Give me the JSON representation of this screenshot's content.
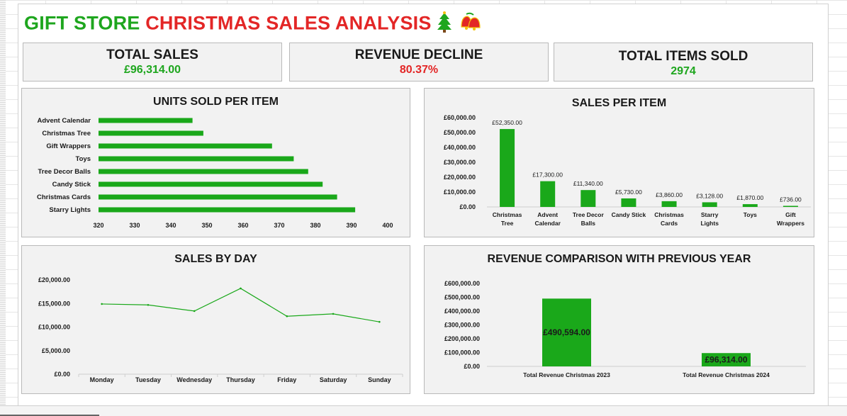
{
  "title": {
    "part1": "GIFT STORE",
    "part2": "CHRISTMAS SALES ANALYSIS",
    "icons": [
      "christmas-tree-icon",
      "bells-icon"
    ]
  },
  "kpis": [
    {
      "label": "TOTAL SALES",
      "value": "£96,314.00",
      "color": "#1ea61e"
    },
    {
      "label": "REVENUE DECLINE",
      "value": "80.37%",
      "color": "#e32626"
    },
    {
      "label": "TOTAL ITEMS SOLD",
      "value": "2974",
      "color": "#1ea61e"
    }
  ],
  "colors": {
    "bar": "#1aa81a",
    "line": "#1aa81a",
    "green_text": "#1ea61e",
    "red_text": "#e32626"
  },
  "chart_data": [
    {
      "type": "bar",
      "orientation": "horizontal",
      "title": "UNITS SOLD PER ITEM",
      "categories": [
        "Advent Calendar",
        "Christmas Tree",
        "Gift Wrappers",
        "Toys",
        "Tree Decor Balls",
        "Candy Stick",
        "Christmas Cards",
        "Starry Lights"
      ],
      "values": [
        346,
        349,
        368,
        374,
        378,
        382,
        386,
        391
      ],
      "xlim": [
        320,
        400
      ],
      "xticks": [
        "320",
        "330",
        "340",
        "350",
        "360",
        "370",
        "380",
        "390",
        "400"
      ],
      "grid": false
    },
    {
      "type": "bar",
      "title": "SALES PER ITEM",
      "categories": [
        "Christmas Tree",
        "Advent Calendar",
        "Tree Decor Balls",
        "Candy Stick",
        "Christmas Cards",
        "Starry Lights",
        "Toys",
        "Gift Wrappers"
      ],
      "values": [
        52350,
        17300,
        11340,
        5730,
        3860,
        3128,
        1870,
        736
      ],
      "data_labels": [
        "£52,350.00",
        "£17,300.00",
        "£11,340.00",
        "£5,730.00",
        "£3,860.00",
        "£3,128.00",
        "£1,870.00",
        "£736.00"
      ],
      "ylim": [
        0,
        60000
      ],
      "yticks": [
        "£0.00",
        "£10,000.00",
        "£20,000.00",
        "£30,000.00",
        "£40,000.00",
        "£50,000.00",
        "£60,000.00"
      ],
      "grid": false
    },
    {
      "type": "line",
      "title": "SALES BY DAY",
      "x": [
        "Monday",
        "Tuesday",
        "Wednesday",
        "Thursday",
        "Friday",
        "Saturday",
        "Sunday"
      ],
      "values": [
        14900,
        14700,
        13400,
        18200,
        12300,
        12800,
        11100
      ],
      "ylim": [
        0,
        20000
      ],
      "yticks": [
        "£0.00",
        "£5,000.00",
        "£10,000.00",
        "£15,000.00",
        "£20,000.00"
      ],
      "grid": false
    },
    {
      "type": "bar",
      "title": "REVENUE COMPARISON WITH PREVIOUS YEAR",
      "categories": [
        "Total  Revenue Christmas 2023",
        "Total  Revenue Christmas 2024"
      ],
      "values": [
        490594,
        96314
      ],
      "data_labels": [
        "£490,594.00",
        "£96,314.00"
      ],
      "ylim": [
        0,
        600000
      ],
      "yticks": [
        "£0.00",
        "£100,000.00",
        "£200,000.00",
        "£300,000.00",
        "£400,000.00",
        "£500,000.00",
        "£600,000.00"
      ],
      "grid": false
    }
  ]
}
